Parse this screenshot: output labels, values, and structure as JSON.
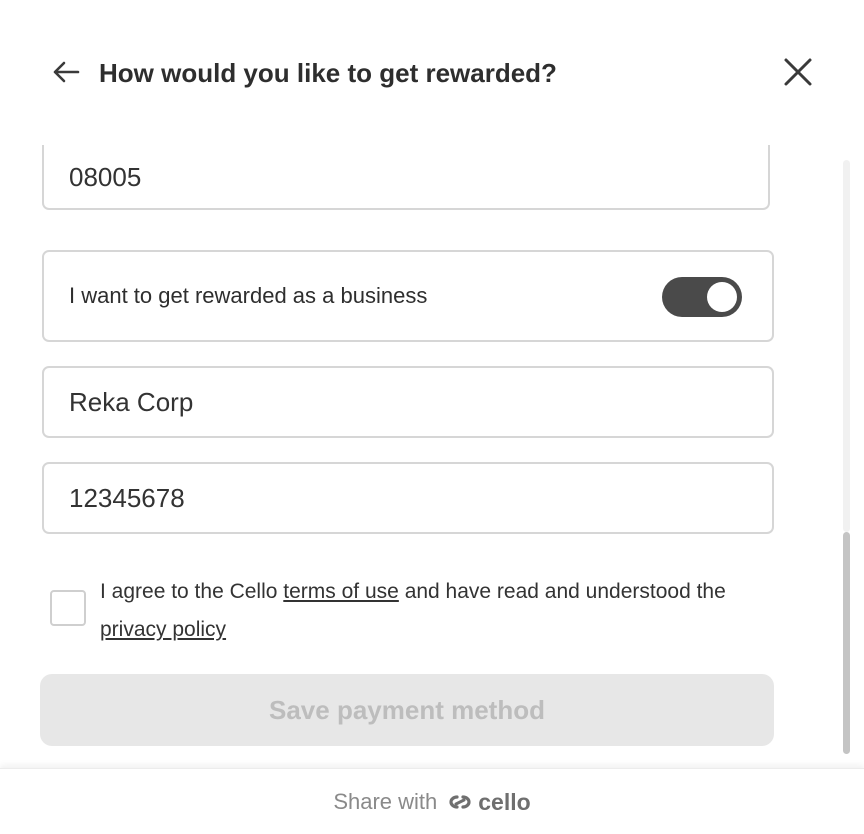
{
  "header": {
    "title": "How would you like to get rewarded?",
    "back_icon": "arrow-left-icon",
    "close_icon": "close-icon"
  },
  "form": {
    "zip_value": "08005",
    "business_toggle_label": "I want to get rewarded as a business",
    "business_toggle_on": true,
    "company_value": "Reka Corp",
    "tax_id_value": "12345678",
    "agree": {
      "prefix": "I agree to the Cello",
      "terms_link": "terms of use",
      "middle": "and have read and understood the",
      "privacy_link": "privacy policy",
      "checked": false
    },
    "save_label": "Save payment method"
  },
  "footer": {
    "share_label": "Share with",
    "brand_name": "cello",
    "brand_icon": "cello-logo-icon"
  },
  "colors": {
    "toggle_on": "#4a4a4a",
    "button_disabled_bg": "#e7e7e7",
    "button_disabled_text": "#bdbdbd",
    "border": "#d6d6d6"
  }
}
